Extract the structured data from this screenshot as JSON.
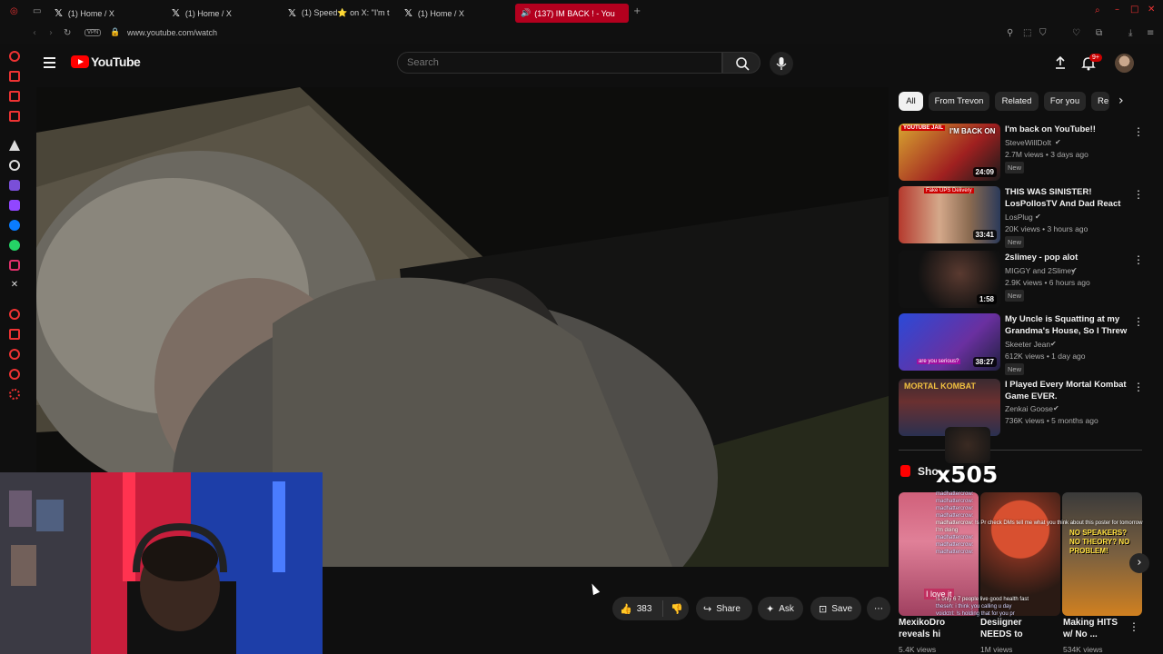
{
  "browser": {
    "tabs": [
      {
        "label": "(1) Home / X",
        "icon": "x-logo"
      },
      {
        "label": "(1) Home / X",
        "icon": "x-logo"
      },
      {
        "label": "(1) Speed⭐ on X: \"I'm th",
        "icon": "x-logo"
      },
      {
        "label": "(1) Home / X",
        "icon": "x-logo"
      },
      {
        "label": "(137) IM BACK ! - You",
        "icon": "youtube-logo",
        "active": true
      }
    ],
    "vpn_label": "VPN",
    "url": "www.youtube.com/watch"
  },
  "header": {
    "logo_text": "YouTube",
    "search_placeholder": "Search",
    "notification_badge": "9+"
  },
  "player": {
    "likes": "383",
    "share_label": "Share",
    "ask_label": "Ask",
    "save_label": "Save"
  },
  "chips": [
    "All",
    "From Trevon",
    "Related",
    "For you",
    "Re"
  ],
  "recommendations": [
    {
      "title": "I'm back on YouTube!!",
      "channel": "SteveWillDoIt",
      "meta": "2.7M views • 3 days ago",
      "new": "New",
      "duration": "24:09",
      "thumb_text": "I'M BACK ON",
      "thumb_badge": "YOUTUBE JAIL"
    },
    {
      "title": "THIS WAS SINISTER! LosPollosTV And Dad React T...",
      "channel": "LosPlug",
      "meta": "20K views • 3 hours ago",
      "new": "New",
      "duration": "33:41",
      "thumb_text": "Fake UPS Delivery"
    },
    {
      "title": "2slimey - pop alot",
      "channel": "MIGGY and 2Slimey",
      "meta": "2.9K views • 6 hours ago",
      "new": "New",
      "duration": "1:58"
    },
    {
      "title": "My Uncle is Squatting at my Grandma's House, So I Threw ...",
      "channel": "Skeeter Jean",
      "meta": "612K views • 1 day ago",
      "new": "New",
      "duration": "38:27",
      "thumb_text": "are you serious?"
    },
    {
      "title": "I Played Every Mortal Kombat Game EVER.",
      "channel": "Zenkai Goose",
      "meta": "736K views • 5 months ago",
      "duration": "",
      "thumb_text": "MORTAL KOMBAT"
    }
  ],
  "shorts": {
    "heading": "Sho",
    "overlay_counter": "x505",
    "items": [
      {
        "title": "MexikoDro",
        "title2": "reveals hi",
        "views": "5.4K views"
      },
      {
        "title": "Desiigner",
        "title2": "NEEDS to",
        "views": "1M views"
      },
      {
        "title": "Making HITS",
        "title2": "w/ No ...",
        "views": "534K views",
        "thumb_text": "NO SPEAKERS? NO THEORY? NO PROBLEM!"
      }
    ],
    "short1_text": "I love it"
  },
  "chat": [
    "madhattercrow:",
    "madhattercrow:",
    "madhattercrow:",
    "madhattercrow:",
    "madhattercrow: !s Pr check DMs tell me what you think about this poster for tomorrow",
    "I'm doing",
    "madhattercrow:",
    "madhattercrow:",
    "madhattercrow:",
    "!s only 6 7 people live good health fast",
    "theseh: i think you calling u day",
    "voidctrl: !s holding that for you pr"
  ],
  "colors": {
    "background": "#0f0f0f",
    "brand_red": "#ff0000",
    "active_tab": "#b3001e",
    "chip_bg": "#272727"
  }
}
